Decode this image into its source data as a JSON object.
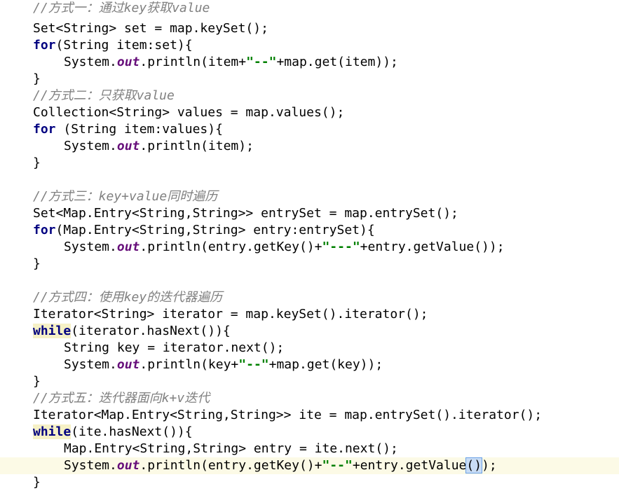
{
  "editor": {
    "lines": [
      {
        "segments": [
          {
            "t": "//方式一：通过key获取value",
            "c": "cm"
          }
        ]
      },
      {
        "segments": [
          {
            "t": "Set<String> set = map.keySet();",
            "c": ""
          }
        ]
      },
      {
        "segments": [
          {
            "t": "for",
            "c": "kw"
          },
          {
            "t": "(String item:set){",
            "c": ""
          }
        ]
      },
      {
        "segments": [
          {
            "t": "System.",
            "c": ""
          },
          {
            "t": "out",
            "c": "fld"
          },
          {
            "t": ".println(item+",
            "c": ""
          },
          {
            "t": "\"--\"",
            "c": "str"
          },
          {
            "t": "+map.get(item));",
            "c": ""
          }
        ]
      },
      {
        "segments": [
          {
            "t": "}",
            "c": ""
          }
        ]
      },
      {
        "segments": [
          {
            "t": "//方式二：只获取value",
            "c": "cm"
          }
        ]
      },
      {
        "segments": [
          {
            "t": "Collection<String> values = map.values();",
            "c": ""
          }
        ]
      },
      {
        "segments": [
          {
            "t": "for",
            "c": "kw"
          },
          {
            "t": " (String item:values){",
            "c": ""
          }
        ]
      },
      {
        "segments": [
          {
            "t": "System.",
            "c": ""
          },
          {
            "t": "out",
            "c": "fld"
          },
          {
            "t": ".println(item);",
            "c": ""
          }
        ]
      },
      {
        "segments": [
          {
            "t": "}",
            "c": ""
          }
        ]
      },
      {
        "segments": []
      },
      {
        "segments": [
          {
            "t": "//方式三：key+value同时遍历",
            "c": "cm"
          }
        ]
      },
      {
        "segments": [
          {
            "t": "Set<Map.Entry<String,String>> entrySet = map.entrySet();",
            "c": ""
          }
        ]
      },
      {
        "segments": [
          {
            "t": "for",
            "c": "kw"
          },
          {
            "t": "(Map.Entry<String,String> entry:entrySet){",
            "c": ""
          }
        ]
      },
      {
        "segments": [
          {
            "t": "System.",
            "c": ""
          },
          {
            "t": "out",
            "c": "fld"
          },
          {
            "t": ".println(entry.getKey()+",
            "c": ""
          },
          {
            "t": "\"---\"",
            "c": "str"
          },
          {
            "t": "+entry.getValue());",
            "c": ""
          }
        ]
      },
      {
        "segments": [
          {
            "t": "}",
            "c": ""
          }
        ]
      },
      {
        "segments": []
      },
      {
        "segments": [
          {
            "t": "//方式四：使用key的迭代器遍历",
            "c": "cm"
          }
        ]
      },
      {
        "segments": [
          {
            "t": "Iterator<String> iterator = map.keySet().iterator();",
            "c": ""
          }
        ]
      },
      {
        "segments": [
          {
            "t": "while",
            "c": "kw hl-kw"
          },
          {
            "t": "(iterator.hasNext()){",
            "c": ""
          }
        ]
      },
      {
        "segments": [
          {
            "t": "String key = iterator.next();",
            "c": ""
          }
        ]
      },
      {
        "segments": [
          {
            "t": "System.",
            "c": ""
          },
          {
            "t": "out",
            "c": "fld"
          },
          {
            "t": ".println(key+",
            "c": ""
          },
          {
            "t": "\"--\"",
            "c": "str"
          },
          {
            "t": "+map.get(key));",
            "c": ""
          }
        ]
      },
      {
        "segments": [
          {
            "t": "}",
            "c": ""
          }
        ]
      },
      {
        "segments": [
          {
            "t": "//方式五：迭代器面向k+v迭代",
            "c": "cm"
          }
        ]
      },
      {
        "segments": [
          {
            "t": "Iterator<Map.Entry<String,String>> ite = map.entrySet().iterator();",
            "c": ""
          }
        ]
      },
      {
        "segments": [
          {
            "t": "while",
            "c": "kw hl-kw"
          },
          {
            "t": "(ite.hasNext()){",
            "c": ""
          }
        ]
      },
      {
        "segments": [
          {
            "t": "Map.Entry<String,String> entry = ite.next();",
            "c": ""
          }
        ]
      },
      {
        "segments": [
          {
            "t": "System.",
            "c": ""
          },
          {
            "t": "out",
            "c": "fld"
          },
          {
            "t": ".println(entry.getKey()+",
            "c": ""
          },
          {
            "t": "\"--\"",
            "c": "str"
          },
          {
            "t": "+entry.getValue",
            "c": ""
          },
          {
            "t": "()",
            "c": "hl-paren"
          },
          {
            "t": ");",
            "c": ""
          }
        ]
      },
      {
        "segments": [
          {
            "t": "}",
            "c": ""
          }
        ]
      }
    ]
  },
  "colors": {
    "keyword": "#000080",
    "string": "#008000",
    "field": "#660e7a",
    "comment": "#808080",
    "current_line": "#fcfae6"
  }
}
